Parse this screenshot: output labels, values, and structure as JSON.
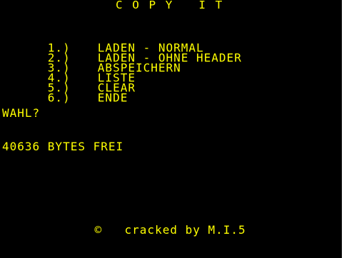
{
  "screen": {
    "bg_color": "#000000",
    "fg_color": "#ffff00"
  },
  "title": "C O P Y   I T",
  "menu": {
    "items": [
      {
        "num": "1.)",
        "label": "LADEN - NORMAL"
      },
      {
        "num": "2.)",
        "label": "LADEN - OHNE HEADER"
      },
      {
        "num": "3.)",
        "label": "ABSPEICHERN"
      },
      {
        "num": "4.)",
        "label": "LISTE"
      },
      {
        "num": "5.)",
        "label": "CLEAR"
      },
      {
        "num": "6.)",
        "label": "ENDE"
      }
    ]
  },
  "prompt": "WAHL?",
  "free_memory": "40636 BYTES FREI",
  "credit": {
    "symbol": "©",
    "text": "cracked by M.I.5"
  }
}
